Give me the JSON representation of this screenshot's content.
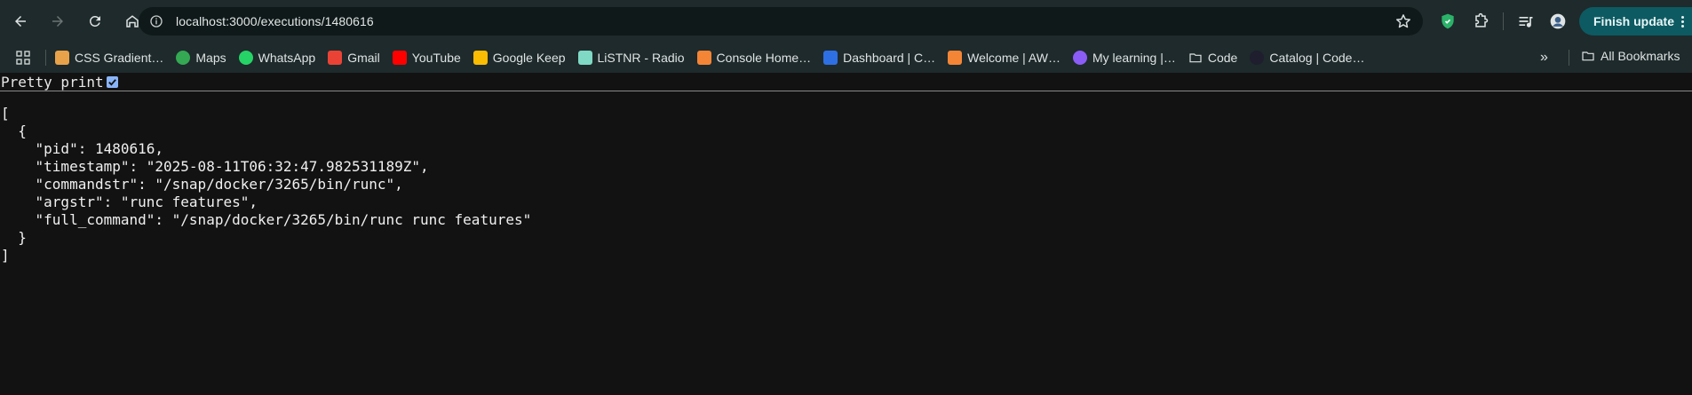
{
  "browser": {
    "url": "localhost:3000/executions/1480616",
    "finish_update_label": "Finish update"
  },
  "bookmarks": [
    {
      "label": "CSS Gradient…",
      "icon": "css-gradient-icon",
      "color": "#e8a24a"
    },
    {
      "label": "Maps",
      "icon": "maps-icon",
      "color": "#34a853"
    },
    {
      "label": "WhatsApp",
      "icon": "whatsapp-icon",
      "color": "#25d366"
    },
    {
      "label": "Gmail",
      "icon": "gmail-icon",
      "color": "#ea4335"
    },
    {
      "label": "YouTube",
      "icon": "youtube-icon",
      "color": "#ff0000"
    },
    {
      "label": "Google Keep",
      "icon": "google-keep-icon",
      "color": "#fbbc04"
    },
    {
      "label": "LiSTNR - Radio",
      "icon": "listnr-icon",
      "color": "#7fd9c5"
    },
    {
      "label": "Console Home…",
      "icon": "aws-icon",
      "color": "#f58536"
    },
    {
      "label": "Dashboard | C…",
      "icon": "dashboard-icon",
      "color": "#2f6fe4"
    },
    {
      "label": "Welcome | AW…",
      "icon": "aws-icon",
      "color": "#f58536"
    },
    {
      "label": "My learning |…",
      "icon": "learning-icon",
      "color": "#8b5cf6"
    },
    {
      "label": "Code",
      "icon": "folder-icon",
      "color": "#dfe3e3"
    },
    {
      "label": "Catalog | Code…",
      "icon": "catalog-icon",
      "color": "#1e1e2e"
    }
  ],
  "bookmarks_more": "»",
  "all_bookmarks_label": "All Bookmarks",
  "pretty_print": {
    "label": "Pretty print",
    "checked": true
  },
  "json_lines": [
    "[",
    "  {",
    "    \"pid\": 1480616,",
    "    \"timestamp\": \"2025-08-11T06:32:47.982531189Z\",",
    "    \"commandstr\": \"/snap/docker/3265/bin/runc\",",
    "    \"argstr\": \"runc features\",",
    "    \"full_command\": \"/snap/docker/3265/bin/runc runc features\"",
    "  }",
    "]"
  ]
}
